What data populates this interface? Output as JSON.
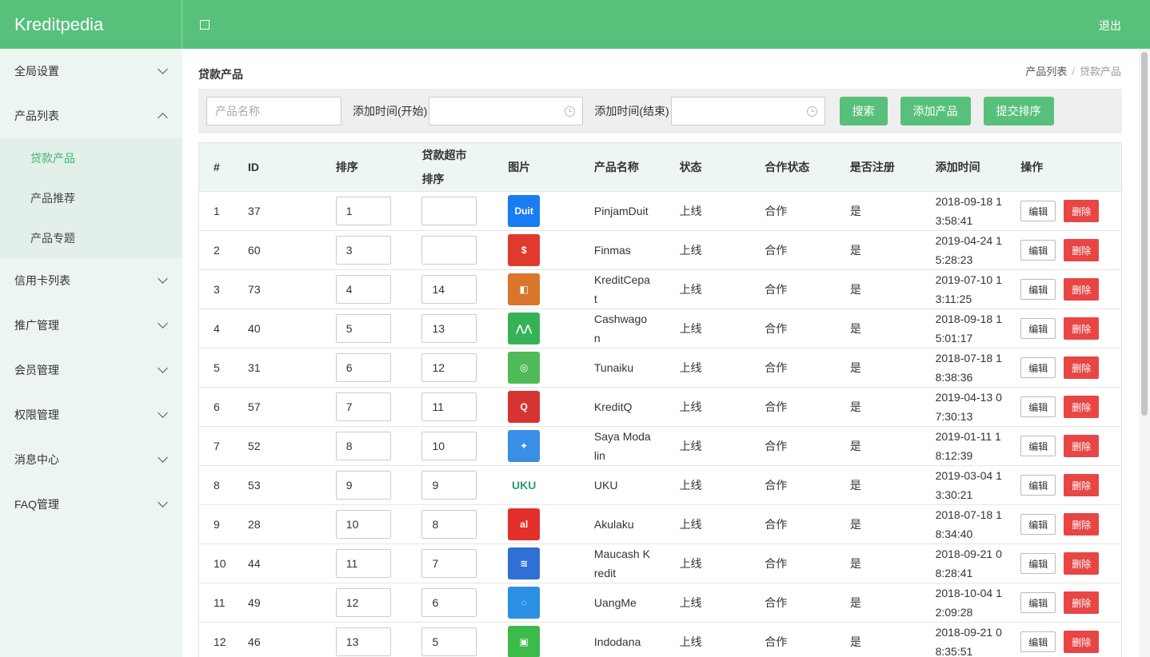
{
  "header": {
    "brand": "Kreditpedia",
    "logout": "退出"
  },
  "sidebar": {
    "items": [
      {
        "label": "全局设置"
      },
      {
        "label": "产品列表",
        "sub": [
          "贷款产品",
          "产品推荐",
          "产品专题"
        ]
      },
      {
        "label": "信用卡列表"
      },
      {
        "label": "推广管理"
      },
      {
        "label": "会员管理"
      },
      {
        "label": "权限管理"
      },
      {
        "label": "消息中心"
      },
      {
        "label": "FAQ管理"
      }
    ],
    "active_sub": "贷款产品"
  },
  "page": {
    "title": "贷款产品"
  },
  "breadcrumb": {
    "parent": "产品列表",
    "current": "贷款产品"
  },
  "filters": {
    "name_placeholder": "产品名称",
    "start_label": "添加时间(开始)",
    "end_label": "添加时间(结束)",
    "search": "搜索",
    "add": "添加产品",
    "submit_sort": "提交排序"
  },
  "table": {
    "headers": [
      "#",
      "ID",
      "排序",
      "贷款超市排序",
      "图片",
      "产品名称",
      "状态",
      "合作状态",
      "是否注册",
      "添加时间",
      "操作"
    ],
    "edit_label": "编辑",
    "delete_label": "删除",
    "rows": [
      {
        "n": "1",
        "id": "37",
        "sort": "1",
        "market_sort": "",
        "logo_color": "#1a7cf2",
        "logo_text": "Duit",
        "name": "PinjamDuit",
        "status": "上线",
        "coop": "合作",
        "reg": "是",
        "time": "2018-09-18 13:58:41"
      },
      {
        "n": "2",
        "id": "60",
        "sort": "3",
        "market_sort": "",
        "logo_color": "#e03a2f",
        "logo_text": "$",
        "name": "Finmas",
        "status": "上线",
        "coop": "合作",
        "reg": "是",
        "time": "2019-04-24 15:28:23"
      },
      {
        "n": "3",
        "id": "73",
        "sort": "4",
        "market_sort": "14",
        "logo_color": "#d9762b",
        "logo_text": "◧",
        "name": "KreditCepat",
        "status": "上线",
        "coop": "合作",
        "reg": "是",
        "time": "2019-07-10 13:11:25"
      },
      {
        "n": "4",
        "id": "40",
        "sort": "5",
        "market_sort": "13",
        "logo_color": "#36b256",
        "logo_text": "⋀⋀",
        "name": "Cashwagon",
        "status": "上线",
        "coop": "合作",
        "reg": "是",
        "time": "2018-09-18 15:01:17"
      },
      {
        "n": "5",
        "id": "31",
        "sort": "6",
        "market_sort": "12",
        "logo_color": "#4fba58",
        "logo_text": "◎",
        "name": "Tunaiku",
        "status": "上线",
        "coop": "合作",
        "reg": "是",
        "time": "2018-07-18 18:38:36"
      },
      {
        "n": "6",
        "id": "57",
        "sort": "7",
        "market_sort": "11",
        "logo_color": "#d63431",
        "logo_text": "Q",
        "name": "KreditQ",
        "status": "上线",
        "coop": "合作",
        "reg": "是",
        "time": "2019-04-13 07:30:13"
      },
      {
        "n": "7",
        "id": "52",
        "sort": "8",
        "market_sort": "10",
        "logo_color": "#3a8ee6",
        "logo_text": "✦",
        "name": "Saya Modalin",
        "status": "上线",
        "coop": "合作",
        "reg": "是",
        "time": "2019-01-11 18:12:39"
      },
      {
        "n": "8",
        "id": "53",
        "sort": "9",
        "market_sort": "9",
        "logo_color": "#ffffff",
        "logo_text": "UKU",
        "name": "UKU",
        "status": "上线",
        "coop": "合作",
        "reg": "是",
        "time": "2019-03-04 13:30:21"
      },
      {
        "n": "9",
        "id": "28",
        "sort": "10",
        "market_sort": "8",
        "logo_color": "#e3302c",
        "logo_text": "al",
        "name": "Akulaku",
        "status": "上线",
        "coop": "合作",
        "reg": "是",
        "time": "2018-07-18 18:34:40"
      },
      {
        "n": "10",
        "id": "44",
        "sort": "11",
        "market_sort": "7",
        "logo_color": "#2f6fd6",
        "logo_text": "≋",
        "name": "Maucash Kredit",
        "status": "上线",
        "coop": "合作",
        "reg": "是",
        "time": "2018-09-21 08:28:41"
      },
      {
        "n": "11",
        "id": "49",
        "sort": "12",
        "market_sort": "6",
        "logo_color": "#2b8fe3",
        "logo_text": "◌",
        "name": "UangMe",
        "status": "上线",
        "coop": "合作",
        "reg": "是",
        "time": "2018-10-04 12:09:28"
      },
      {
        "n": "12",
        "id": "46",
        "sort": "13",
        "market_sort": "5",
        "logo_color": "#3cba4a",
        "logo_text": "▣",
        "name": "Indodana",
        "status": "上线",
        "coop": "合作",
        "reg": "是",
        "time": "2018-09-21 08:35:51"
      }
    ]
  }
}
